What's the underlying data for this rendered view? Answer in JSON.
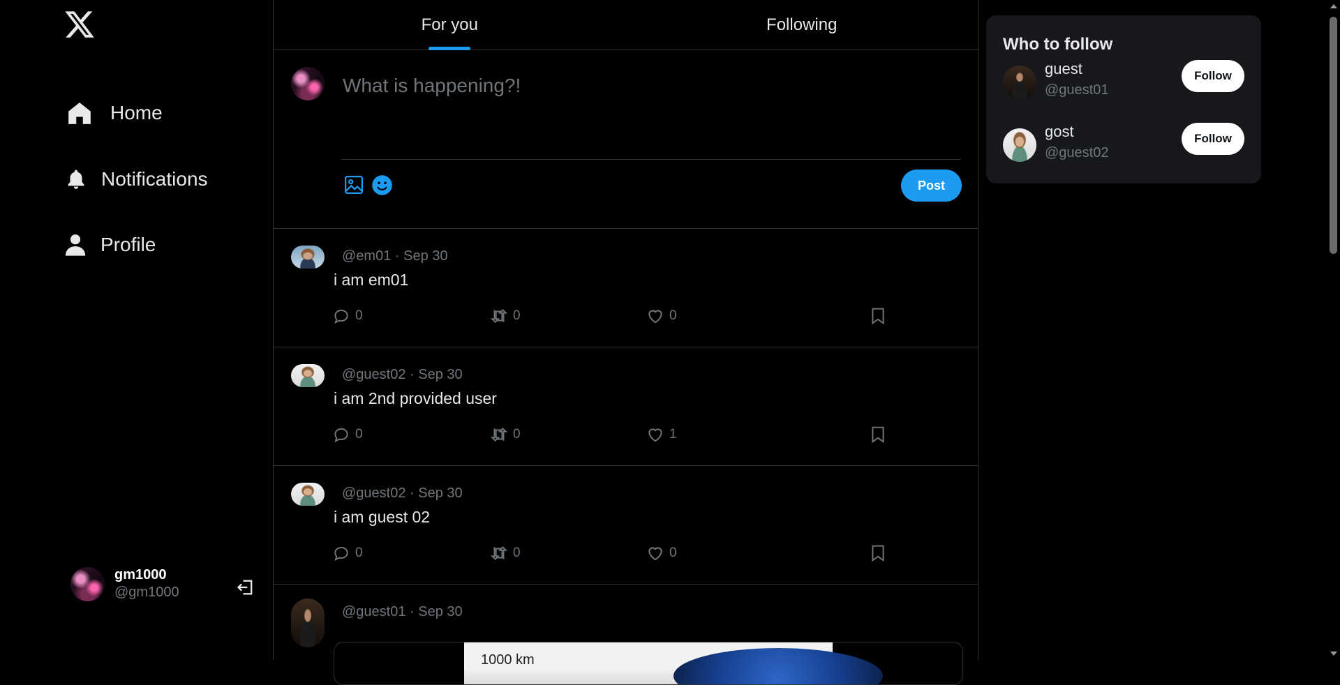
{
  "sidebar": {
    "logo_icon": "x-logo-icon",
    "nav": [
      {
        "label": "Home",
        "icon": "home-icon"
      },
      {
        "label": "Notifications",
        "icon": "bell-icon"
      },
      {
        "label": "Profile",
        "icon": "person-icon"
      }
    ],
    "account": {
      "name": "gm1000",
      "handle": "@gm1000",
      "logout_icon": "logout-icon"
    }
  },
  "tabs": [
    {
      "label": "For you",
      "active": true
    },
    {
      "label": "Following",
      "active": false
    }
  ],
  "composer": {
    "placeholder": "What is happening?!",
    "post_label": "Post",
    "icons": [
      "image-icon",
      "emoji-icon"
    ]
  },
  "feed": [
    {
      "handle": "@em01",
      "date": "Sep 30",
      "text": "i am em01",
      "replies": "0",
      "reposts": "0",
      "likes": "0"
    },
    {
      "handle": "@guest02",
      "date": "Sep 30",
      "text": "i am 2nd provided user",
      "replies": "0",
      "reposts": "0",
      "likes": "1"
    },
    {
      "handle": "@guest02",
      "date": "Sep 30",
      "text": "i am guest 02",
      "replies": "0",
      "reposts": "0",
      "likes": "0"
    },
    {
      "handle": "@guest01",
      "date": "Sep 30",
      "media_label": "1000 km"
    }
  ],
  "who_to_follow": {
    "title": "Who to follow",
    "users": [
      {
        "name": "guest",
        "handle": "@guest01",
        "button": "Follow"
      },
      {
        "name": "gost",
        "handle": "@guest02",
        "button": "Follow"
      }
    ]
  },
  "colors": {
    "accent": "#1d9bf0",
    "background": "#000000",
    "muted": "#71767b",
    "border": "#2f3336"
  }
}
